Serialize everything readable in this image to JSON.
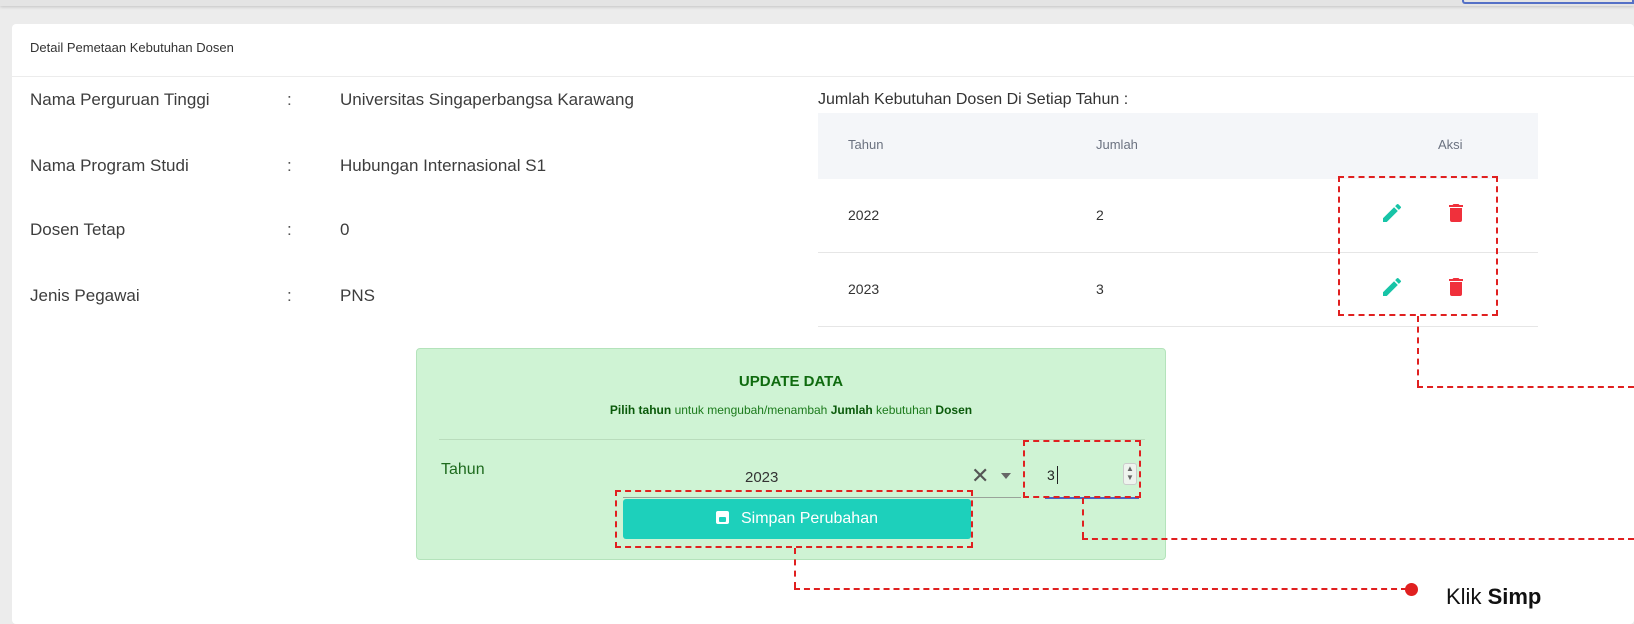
{
  "card": {
    "title": "Detail Pemetaan Kebutuhan Dosen"
  },
  "info": {
    "colon": ":",
    "rows": [
      {
        "label": "Nama Perguruan Tinggi",
        "value": "Universitas Singaperbangsa Karawang"
      },
      {
        "label": "Nama Program Studi",
        "value": "Hubungan Internasional S1"
      },
      {
        "label": "Dosen Tetap",
        "value": "0"
      },
      {
        "label": "Jenis Pegawai",
        "value": "PNS"
      }
    ]
  },
  "table": {
    "title": "Jumlah Kebutuhan Dosen Di Setiap Tahun :",
    "headers": {
      "tahun": "Tahun",
      "jumlah": "Jumlah",
      "aksi": "Aksi"
    },
    "rows": [
      {
        "tahun": "2022",
        "jumlah": "2"
      },
      {
        "tahun": "2023",
        "jumlah": "3"
      }
    ]
  },
  "update": {
    "title": "UPDATE DATA",
    "subtitle": {
      "part1": "Pilih tahun",
      "part2": " untuk mengubah/menambah ",
      "part3": "Jumlah",
      "part4": " kebutuhan ",
      "part5": "Dosen"
    },
    "tahun_label": "Tahun",
    "tahun_value": "2023",
    "jumlah_value": "3",
    "save_label": "Simpan Perubahan"
  },
  "annotation": {
    "text_start": "Klik ",
    "text_bold": "Simp"
  },
  "colors": {
    "accent": "#1dd0bb",
    "edit": "#17c4a7",
    "delete": "#f0303b",
    "highlight": "#e02020",
    "update_bg": "#cff3d4"
  },
  "icons": {
    "edit": "pencil-icon",
    "delete": "trash-icon",
    "save": "floppy-icon",
    "clear": "close-icon",
    "dropdown": "chevron-down-icon"
  }
}
